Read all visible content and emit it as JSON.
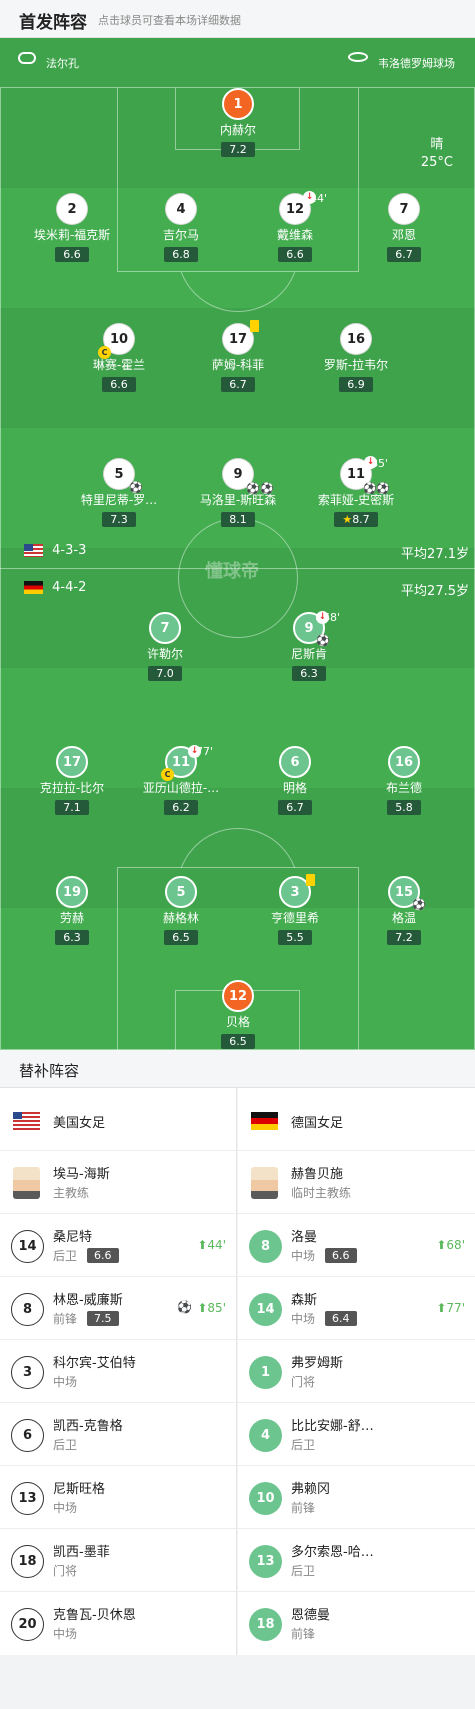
{
  "header": {
    "title": "首发阵容",
    "subtitle": "点击球员可查看本场详细数据"
  },
  "venue": {
    "referee": "法尔孔",
    "stadium": "韦洛德罗姆球场"
  },
  "weather": {
    "condition": "晴",
    "temp": "25°C"
  },
  "home": {
    "formation": "4-3-3",
    "avg_age": "平均27.1岁",
    "players": [
      {
        "num": "1",
        "name": "内赫尔",
        "rating": "7.2"
      },
      {
        "num": "2",
        "name": "埃米莉-福克斯",
        "rating": "6.6"
      },
      {
        "num": "4",
        "name": "吉尔马",
        "rating": "6.8"
      },
      {
        "num": "12",
        "name": "戴维森",
        "rating": "6.6",
        "sub_min": "44'"
      },
      {
        "num": "7",
        "name": "邓恩",
        "rating": "6.7"
      },
      {
        "num": "10",
        "name": "琳赛-霍兰",
        "rating": "6.6"
      },
      {
        "num": "17",
        "name": "萨姆-科菲",
        "rating": "6.7"
      },
      {
        "num": "16",
        "name": "罗斯-拉韦尔",
        "rating": "6.9"
      },
      {
        "num": "5",
        "name": "特里尼蒂-罗…",
        "rating": "7.3"
      },
      {
        "num": "9",
        "name": "马洛里-斯旺森",
        "rating": "8.1"
      },
      {
        "num": "11",
        "name": "索菲娅-史密斯",
        "rating": "8.7",
        "sub_min": "85'"
      }
    ]
  },
  "away": {
    "formation": "4-4-2",
    "avg_age": "平均27.5岁",
    "players": [
      {
        "num": "7",
        "name": "许勒尔",
        "rating": "7.0"
      },
      {
        "num": "9",
        "name": "尼斯肯",
        "rating": "6.3",
        "sub_min": "68'"
      },
      {
        "num": "17",
        "name": "克拉拉-比尔",
        "rating": "7.1"
      },
      {
        "num": "11",
        "name": "亚历山德拉-…",
        "rating": "6.2",
        "sub_min": "77'"
      },
      {
        "num": "6",
        "name": "明格",
        "rating": "6.7"
      },
      {
        "num": "16",
        "name": "布兰德",
        "rating": "5.8"
      },
      {
        "num": "19",
        "name": "劳赫",
        "rating": "6.3"
      },
      {
        "num": "5",
        "name": "赫格林",
        "rating": "6.5"
      },
      {
        "num": "3",
        "name": "亨德里希",
        "rating": "5.5"
      },
      {
        "num": "15",
        "name": "格温",
        "rating": "7.2"
      },
      {
        "num": "12",
        "name": "贝格",
        "rating": "6.5"
      }
    ]
  },
  "subs": {
    "title": "替补阵容",
    "left": {
      "team": "美国女足",
      "coach": {
        "name": "埃马-海斯",
        "role": "主教练"
      },
      "rows": [
        {
          "num": "14",
          "name": "桑尼特",
          "pos": "后卫",
          "rating": "6.6",
          "min": "44'"
        },
        {
          "num": "8",
          "name": "林恩-威廉斯",
          "pos": "前锋",
          "rating": "7.5",
          "min": "85'"
        },
        {
          "num": "3",
          "name": "科尔宾-艾伯特",
          "pos": "中场"
        },
        {
          "num": "6",
          "name": "凯西-克鲁格",
          "pos": "后卫"
        },
        {
          "num": "13",
          "name": "尼斯旺格",
          "pos": "中场"
        },
        {
          "num": "18",
          "name": "凯西-墨菲",
          "pos": "门将"
        },
        {
          "num": "20",
          "name": "克鲁瓦-贝休恩",
          "pos": "中场"
        }
      ]
    },
    "right": {
      "team": "德国女足",
      "coach": {
        "name": "赫鲁贝施",
        "role": "临时主教练"
      },
      "rows": [
        {
          "num": "8",
          "name": "洛曼",
          "pos": "中场",
          "rating": "6.6",
          "min": "68'"
        },
        {
          "num": "14",
          "name": "森斯",
          "pos": "中场",
          "rating": "6.4",
          "min": "77'"
        },
        {
          "num": "1",
          "name": "弗罗姆斯",
          "pos": "门将"
        },
        {
          "num": "4",
          "name": "比比安娜-舒…",
          "pos": "后卫"
        },
        {
          "num": "10",
          "name": "弗赖冈",
          "pos": "前锋"
        },
        {
          "num": "13",
          "name": "多尔索恩-哈…",
          "pos": "后卫"
        },
        {
          "num": "18",
          "name": "恩德曼",
          "pos": "前锋"
        }
      ]
    }
  }
}
